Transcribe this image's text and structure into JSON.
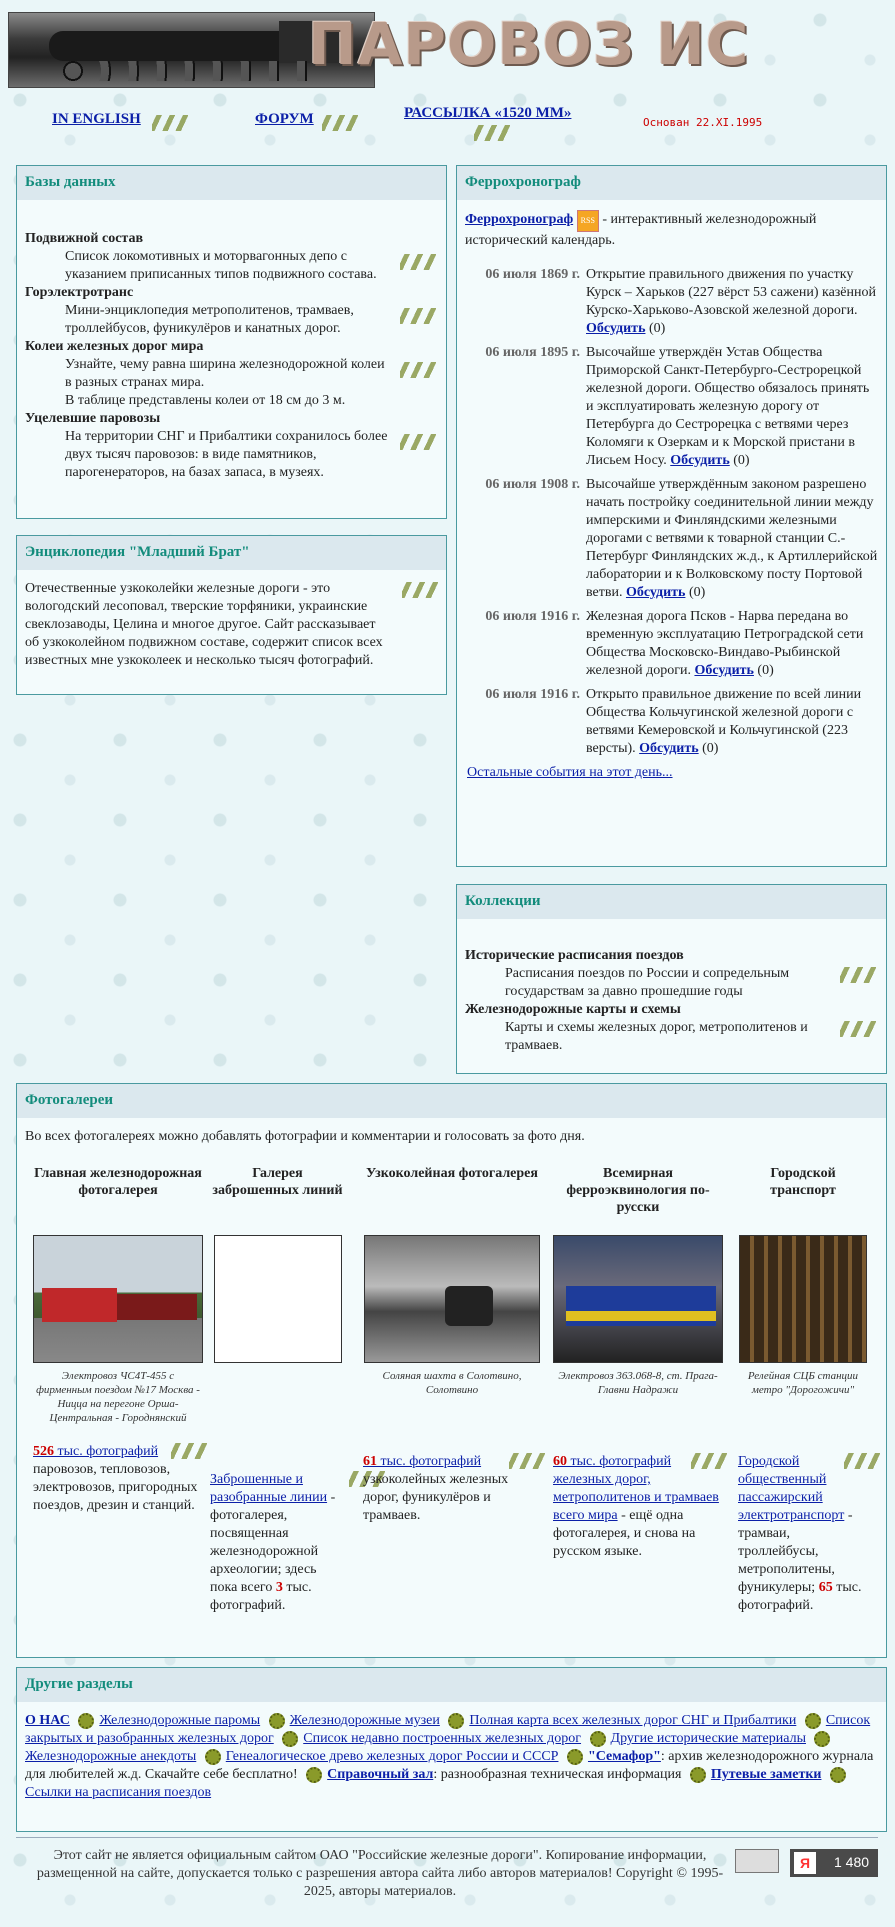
{
  "header": {
    "logo_text": "ПАРОВОЗ ИС",
    "founded": "Основан 22.XI.1995"
  },
  "topnav": {
    "english": "IN ENGLISH",
    "forum": "ФОРУМ",
    "mailing": "РАССЫЛКА «1520 ММ»"
  },
  "databases": {
    "title": "Базы данных",
    "items": [
      {
        "title": "Подвижной состав",
        "desc": "Список локомотивных и моторвагонных депо с указанием приписанных типов подвижного состава."
      },
      {
        "title": "Горэлектротранс",
        "desc": "Мини-энциклопедия метрополитенов, трамваев, троллейбусов, фуникулёров и канатных дорог."
      },
      {
        "title": "Колеи железных дорог мира",
        "desc": "Узнайте, чему равна ширина железнодорожной колеи в разных странах мира.",
        "desc2": "В таблице представлены колеи от 18 см до 3 м."
      },
      {
        "title": "Уцелевшие паровозы",
        "desc": "На территории СНГ и Прибалтики сохранилось более двух тысяч паровозов: в виде памятников, парогенераторов, на базах запаса, в музеях."
      }
    ]
  },
  "encyclopedia": {
    "title": "Энциклопедия \"Младший Брат\"",
    "text": "Отечественные узкоколейки железные дороги - это вологодский лесоповал, тверские торфяники, украинские свеклозаводы, Целина и многое другое. Сайт рассказывает об узкоколейном подвижном составе, содержит список всех известных мне узкоколеек и несколько тысяч фотографий."
  },
  "ferro": {
    "title": "Феррохронограф",
    "link": "Феррохронограф",
    "rss": "RSS",
    "intro": " - интерактивный железнодорожный исторический календарь.",
    "discuss": "Обсудить",
    "events": [
      {
        "date": "06 июля 1869 г.",
        "text": "Открытие правильного движения по участку Курск – Харьков (227 вёрст 53 сажени) казённой Курско-Харьково-Азовской железной дороги. ",
        "count": " (0)"
      },
      {
        "date": "06 июля 1895 г.",
        "text": "Высочайше утверждён Устав Общества Приморской Санкт-Петербурго-Сестрорецкой железной дороги. Общество обязалось принять и эксплуатировать железную дорогу от Петербурга до Сестрорецка с ветвями через Коломяги к Озеркам и к Морской пристани в Лисьем Носу. ",
        "count": " (0)"
      },
      {
        "date": "06 июля 1908 г.",
        "text": "Высочайше утверждённым законом разрешено начать постройку соединительной линии между имперскими и Финляндскими железными дорогами с ветвями к товарной станции С.-Петербург Финляндских ж.д., к Артиллерийской лаборатории и к Волковскому посту Портовой ветви. ",
        "count": " (0)"
      },
      {
        "date": "06 июля 1916 г.",
        "text": "Железная дорога Псков - Нарва передана во временную эксплуатацию Петроградской сети Общества Московско-Виндаво-Рыбинской железной дороги. ",
        "count": " (0)"
      },
      {
        "date": "06 июля 1916 г.",
        "text": "Открыто правильное движение по всей линии Общества Кольчугинской железной дороги с ветвями Кемеровской и Кольчугинской (223 версты). ",
        "count": " (0)"
      }
    ],
    "more": "Остальные события на этот день..."
  },
  "collections": {
    "title": "Коллекции",
    "items": [
      {
        "title": "Исторические расписания поездов",
        "desc": "Расписания поездов по России и сопредельным государствам за давно прошедшие годы"
      },
      {
        "title": "Железнодорожные карты и схемы",
        "desc": "Карты и схемы железных дорог, метрополитенов и трамваев."
      }
    ]
  },
  "gallery": {
    "title": "Фотогалереи",
    "intro": "Во всех фотогалереях можно добавлять фотографии и комментарии и голосовать за фото дня.",
    "cols": [
      {
        "title": "Главная железнодорожная фотогалерея",
        "caption": "Электровоз ЧС4Т-455 с фирменным поездом №17 Москва - Ницца на перегоне Орша-Центральная - Городнянский",
        "num": "526",
        "link": " тыс. фотографий",
        "desc": "паровозов, тепловозов, электровозов, пригородных поездов, дрезин и станций."
      },
      {
        "title": "Галерея заброшенных линий",
        "caption": "",
        "link": "Заброшенные и разобранные линии",
        "desc": " - фотогалерея, посвященная железнодорожной археологии; здесь пока всего ",
        "num": "3",
        "desc2": " тыс. фотографий."
      },
      {
        "title": "Узкоколейная фотогалерея",
        "caption": "Соляная шахта в Солотвино, Солотвино",
        "num": "61",
        "link": " тыс. фотографий",
        "desc": "узкоколейных железных дорог, фуникулёров и трамваев."
      },
      {
        "title": "Всемирная ферроэквинология по-русски",
        "caption": "Электровоз 363.068-8, ст. Прага-Главни Надражи",
        "num": "60",
        "link": " тыс. фотографий железных дорог, метрополитенов и трамваев всего мира",
        "desc": " - ещё одна фотогалерея, и снова на русском языке."
      },
      {
        "title": "Городской транспорт",
        "caption": "Релейная СЦБ станции метро \"Дорогожичи\"",
        "link": "Городской общественный пассажирский электротранспорт",
        "desc": " - трамваи, троллейбусы, метрополитены, фуникулеры; ",
        "num": "65",
        "desc2": " тыс. фотографий."
      }
    ]
  },
  "other": {
    "title": "Другие разделы",
    "links": [
      "О НАС",
      "Железнодорожные паромы",
      "Железнодорожные музеи",
      "Полная карта всех железных дорог СНГ и Прибалтики",
      "Список закрытых и разобранных железных дорог",
      "Список недавно построенных железных дорог",
      "Другие исторические материалы",
      "Железнодорожные анекдоты",
      "Генеалогическое древо железных дорог России и СССР",
      "\"Семафор\"",
      "Справочный зал",
      "Путевые заметки",
      "Ссылки на расписания поездов"
    ],
    "semafor_desc": ": архив железнодорожного журнала для любителей ж.д. Скачайте себе бесплатно!",
    "zal_desc": ": разнообразная техническая информация"
  },
  "footer": {
    "copyright": "Этот сайт не является официальным сайтом ОАО \"Российские железные дороги\". Копирование информации, размещенной на сайте, допускается только с разрешения автора сайта либо авторов материалов! Copyright © 1995-2025, авторы материалов.",
    "counter_letter": "Я",
    "counter": "1 480"
  }
}
